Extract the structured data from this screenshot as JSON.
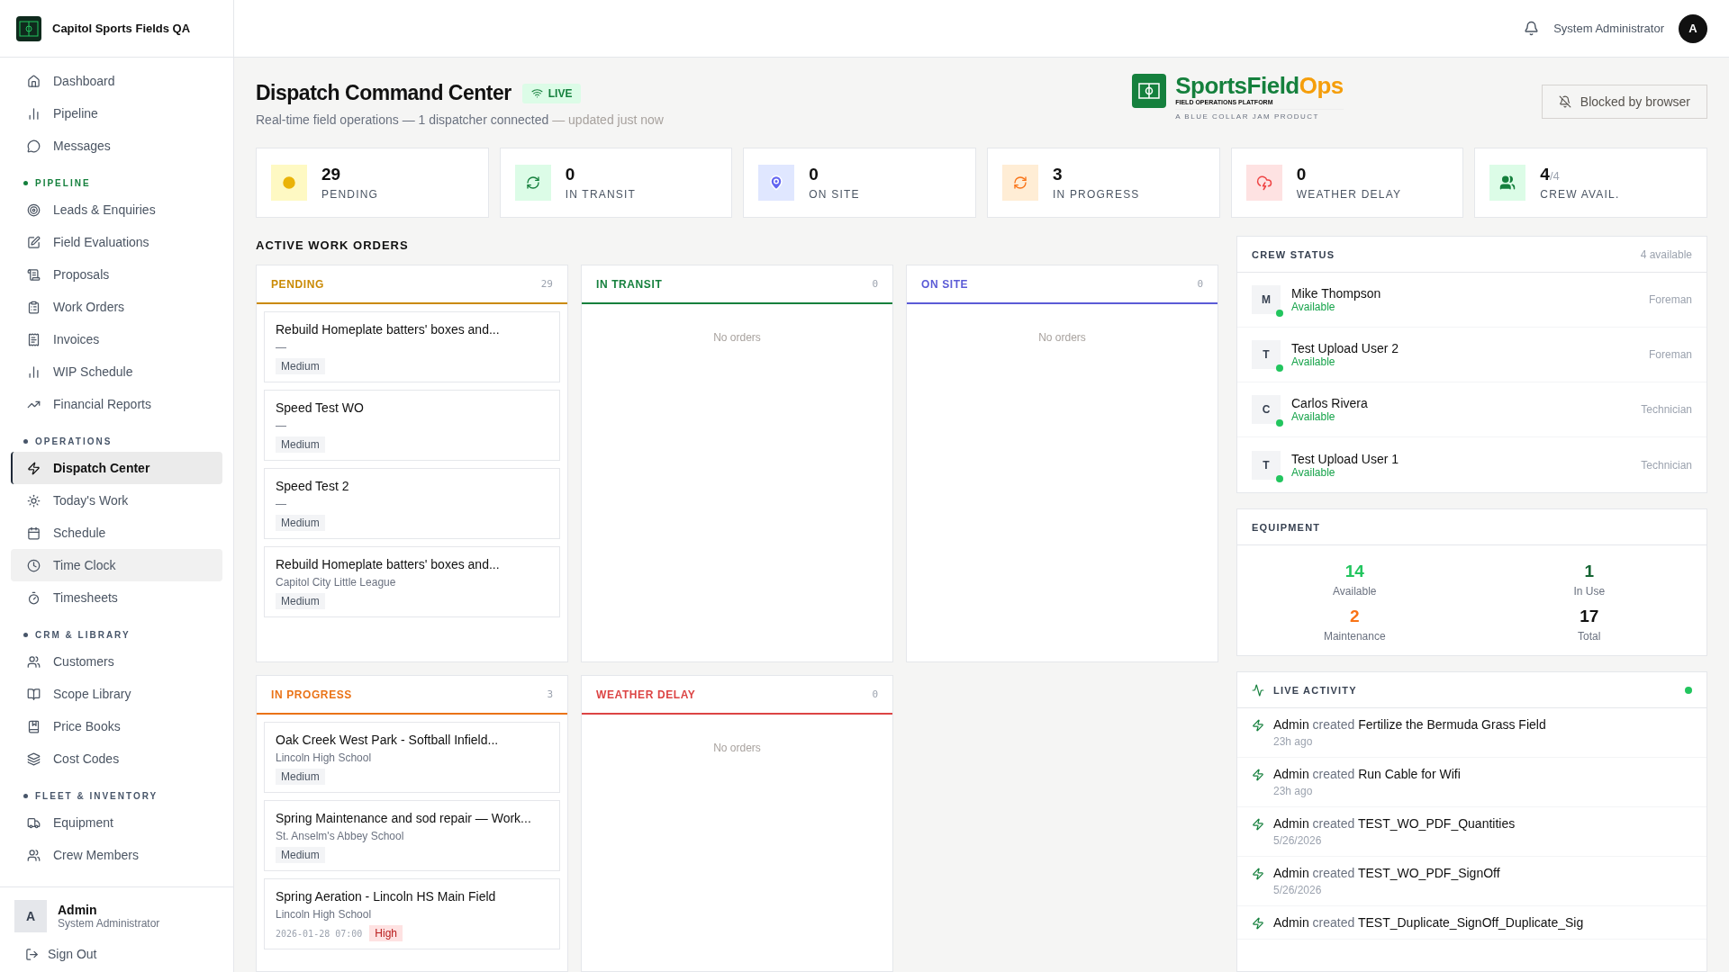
{
  "org": {
    "name": "Capitol Sports Fields QA"
  },
  "sidebar": {
    "top_items": [
      {
        "label": "Dashboard",
        "selected": false,
        "highlighted": false
      },
      {
        "label": "Pipeline",
        "selected": false,
        "highlighted": false
      },
      {
        "label": "Messages",
        "selected": false,
        "highlighted": false
      }
    ],
    "sections": [
      {
        "label": "PIPELINE",
        "kind": "accent",
        "items": [
          {
            "label": "Leads & Enquiries",
            "selected": false,
            "highlighted": false
          },
          {
            "label": "Field Evaluations",
            "selected": false,
            "highlighted": false
          },
          {
            "label": "Proposals",
            "selected": false,
            "highlighted": false
          },
          {
            "label": "Work Orders",
            "selected": false,
            "highlighted": false
          },
          {
            "label": "Invoices",
            "selected": false,
            "highlighted": false
          },
          {
            "label": "WIP Schedule",
            "selected": false,
            "highlighted": false
          },
          {
            "label": "Financial Reports",
            "selected": false,
            "highlighted": false
          }
        ]
      },
      {
        "label": "OPERATIONS",
        "kind": "plain",
        "items": [
          {
            "label": "Dispatch Center",
            "selected": true,
            "highlighted": false
          },
          {
            "label": "Today's Work",
            "selected": false,
            "highlighted": false
          },
          {
            "label": "Schedule",
            "selected": false,
            "highlighted": false
          },
          {
            "label": "Time Clock",
            "selected": false,
            "highlighted": true
          },
          {
            "label": "Timesheets",
            "selected": false,
            "highlighted": false
          }
        ]
      },
      {
        "label": "CRM & LIBRARY",
        "kind": "plain",
        "items": [
          {
            "label": "Customers",
            "selected": false,
            "highlighted": false
          },
          {
            "label": "Scope Library",
            "selected": false,
            "highlighted": false
          },
          {
            "label": "Price Books",
            "selected": false,
            "highlighted": false
          },
          {
            "label": "Cost Codes",
            "selected": false,
            "highlighted": false
          }
        ]
      },
      {
        "label": "FLEET & INVENTORY",
        "kind": "plain",
        "items": [
          {
            "label": "Equipment",
            "selected": false,
            "highlighted": false
          },
          {
            "label": "Crew Members",
            "selected": false,
            "highlighted": false
          }
        ]
      }
    ],
    "user": {
      "initial": "A",
      "name": "Admin",
      "role": "System Administrator"
    },
    "sign_out": "Sign Out"
  },
  "topbar": {
    "user_name": "System Administrator",
    "avatar": "A"
  },
  "page": {
    "title": "Dispatch Command Center",
    "live_badge": "LIVE",
    "subtitle": "Real-time field operations — 1 dispatcher connected",
    "updated": "— updated just now",
    "blocked_button": "Blocked by browser"
  },
  "logo": {
    "primary": "SportsField",
    "accent": "Ops",
    "tagline": "FIELD OPERATIONS PLATFORM",
    "sub": "A BLUE COLLAR JAM PRODUCT"
  },
  "stats": [
    {
      "kind": "pending",
      "value": "29",
      "label": "PENDING"
    },
    {
      "kind": "transit",
      "value": "0",
      "label": "IN TRANSIT"
    },
    {
      "kind": "onsite",
      "value": "0",
      "label": "ON SITE"
    },
    {
      "kind": "progress",
      "value": "3",
      "label": "IN PROGRESS"
    },
    {
      "kind": "weather",
      "value": "0",
      "label": "WEATHER DELAY"
    },
    {
      "kind": "crew",
      "value": "4",
      "suffix": "/4",
      "label": "CREW AVAIL."
    }
  ],
  "work_orders": {
    "title": "ACTIVE WORK ORDERS",
    "empty_text": [
      "No orders",
      "No orders",
      "No orders"
    ],
    "columns": [
      {
        "kind": "pending",
        "title": "PENDING",
        "count": "29",
        "cards": [
          {
            "title": "Rebuild Homeplate batters' boxes and...",
            "subtitle": "—",
            "priority": "Medium",
            "kind": "medium"
          },
          {
            "title": "Speed Test WO",
            "subtitle": "—",
            "priority": "Medium",
            "kind": "medium"
          },
          {
            "title": "Speed Test 2",
            "subtitle": "—",
            "priority": "Medium",
            "kind": "medium"
          },
          {
            "title": "Rebuild Homeplate batters' boxes and...",
            "subtitle": "Capitol City Little League",
            "priority": "Medium",
            "kind": "medium"
          }
        ]
      },
      {
        "kind": "transit",
        "title": "IN TRANSIT",
        "count": "0"
      },
      {
        "kind": "onsite",
        "title": "ON SITE",
        "count": "0"
      },
      {
        "kind": "progress",
        "title": "IN PROGRESS",
        "count": "3",
        "cards": [
          {
            "title": "Oak Creek West Park - Softball Infield...",
            "subtitle": "Lincoln High School",
            "priority": "Medium",
            "kind": "medium"
          },
          {
            "title": "Spring Maintenance and sod repair — Work...",
            "subtitle": "St. Anselm's Abbey School",
            "priority": "Medium",
            "kind": "medium"
          },
          {
            "title": "Spring Aeration - Lincoln HS Main Field",
            "subtitle": "Lincoln High School",
            "date": "2026-01-28 07:00",
            "priority": "High",
            "kind": "high"
          }
        ]
      },
      {
        "kind": "weather",
        "title": "WEATHER DELAY",
        "count": "0"
      }
    ]
  },
  "crew_status": {
    "title": "CREW STATUS",
    "count": "4 available",
    "members": [
      {
        "initial": "M",
        "name": "Mike Thompson",
        "status": "Available",
        "available": true,
        "role": "Foreman"
      },
      {
        "initial": "T",
        "name": "Test Upload User 2",
        "status": "Available",
        "available": true,
        "role": "Foreman"
      },
      {
        "initial": "C",
        "name": "Carlos Rivera",
        "status": "Available",
        "available": true,
        "role": "Technician"
      },
      {
        "initial": "T",
        "name": "Test Upload User 1",
        "status": "Available",
        "available": true,
        "role": "Technician"
      }
    ]
  },
  "equipment": {
    "title": "EQUIPMENT",
    "stats": [
      {
        "kind": "available",
        "value": "14",
        "label": "Available"
      },
      {
        "kind": "in_use",
        "value": "1",
        "label": "In Use"
      },
      {
        "kind": "maintenance",
        "value": "2",
        "label": "Maintenance"
      },
      {
        "kind": "total",
        "value": "17",
        "label": "Total"
      }
    ]
  },
  "live_activity": {
    "title": "LIVE ACTIVITY",
    "connected": true,
    "events": [
      {
        "actor": "Admin",
        "verb": "created",
        "object": "Fertilize the Bermuda Grass Field",
        "time": "23h ago"
      },
      {
        "actor": "Admin",
        "verb": "created",
        "object": "Run Cable for Wifi",
        "time": "23h ago"
      },
      {
        "actor": "Admin",
        "verb": "created",
        "object": "TEST_WO_PDF_Quantities",
        "time": "5/26/2026"
      },
      {
        "actor": "Admin",
        "verb": "created",
        "object": "TEST_WO_PDF_SignOff",
        "time": "5/26/2026"
      },
      {
        "actor": "Admin",
        "verb": "created",
        "object": "TEST_Duplicate_SignOff_Duplicate_Sig"
      }
    ]
  }
}
